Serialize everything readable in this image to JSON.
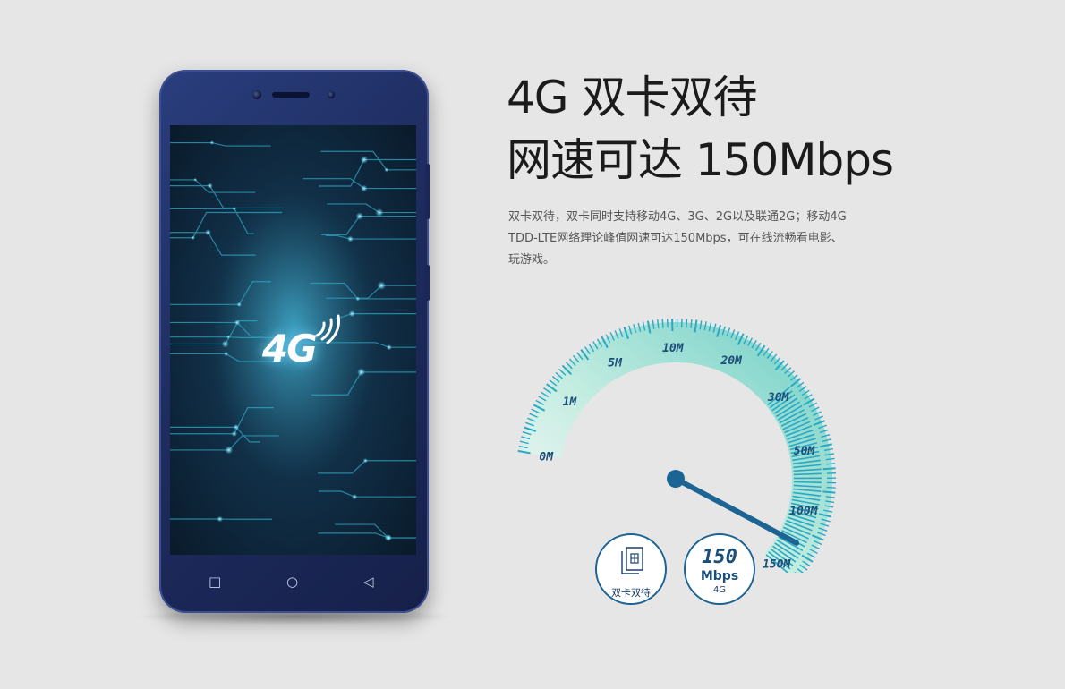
{
  "headline": {
    "line1": "4G 双卡双待",
    "line2": "网速可达 150Mbps"
  },
  "description": {
    "line1": "双卡双待，双卡同时支持移动4G、3G、2G以及联通2G；移动4G",
    "line2": "TDD-LTE网络理论峰值网速可达150Mbps，可在线流畅看电影、",
    "line3": "玩游戏。"
  },
  "phone": {
    "screen_logo": "4G",
    "nav_icons": [
      "square-icon",
      "circle-icon",
      "back-triangle-icon"
    ],
    "body_color": "#1e2c5f"
  },
  "gauge": {
    "labels": [
      "0M",
      "1M",
      "5M",
      "10M",
      "20M",
      "30M",
      "50M",
      "100M",
      "150M"
    ],
    "current_value_mbps": 150,
    "accent_color": "#29a9c4",
    "needle_color": "#1c6493"
  },
  "badges": {
    "dual_sim": {
      "icon": "sim-card-icon",
      "label": "双卡双待"
    },
    "speed": {
      "value": "150",
      "unit": "Mbps",
      "network": "4G"
    }
  }
}
